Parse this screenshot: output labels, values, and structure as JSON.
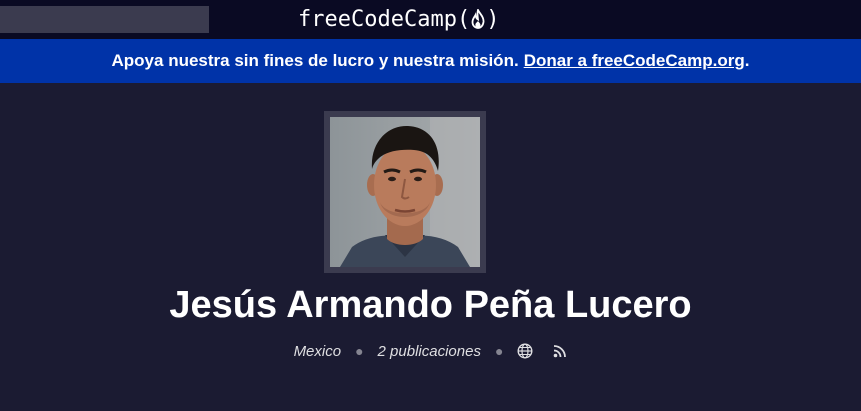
{
  "nav": {
    "search_placeholder": "",
    "logo_text": "freeCodeCamp",
    "logo_paren_open": "(",
    "logo_paren_close": ")",
    "logo_icon": "fire-icon"
  },
  "banner": {
    "text": "Apoya nuestra sin fines de lucro y nuestra misión.",
    "link_text": "Donar a freeCodeCamp.org",
    "suffix": "."
  },
  "author": {
    "name": "Jesús Armando Peña Lucero",
    "location": "Mexico",
    "posts": "2 publicaciones",
    "icons": [
      "globe-icon",
      "rss-icon"
    ]
  },
  "colors": {
    "background": "#1b1b32",
    "nav": "#0a0a23",
    "banner": "#0033a8",
    "text": "#ffffff"
  }
}
